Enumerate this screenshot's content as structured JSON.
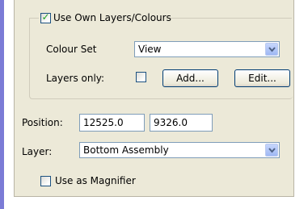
{
  "own_layers": {
    "checkbox_label": "Use Own Layers/Colours",
    "checked": true
  },
  "colour_set": {
    "label": "Colour Set",
    "value": "View"
  },
  "layers_only": {
    "label": "Layers only:",
    "checked": false,
    "add_button": "Add...",
    "edit_button": "Edit..."
  },
  "position": {
    "label": "Position:",
    "x": "12525.0",
    "y": "9326.0"
  },
  "layer": {
    "label": "Layer:",
    "value": "Bottom Assembly"
  },
  "magnifier": {
    "checkbox_label": "Use as Magnifier",
    "checked": false
  },
  "colors": {
    "panel": "#ece9d8",
    "accent_bar": "#7b7bd6",
    "check_green": "#21a121",
    "input_border": "#7f9db9"
  },
  "icons": {
    "dropdown": "chevron-down-icon",
    "checkmark": "checkmark-icon"
  }
}
